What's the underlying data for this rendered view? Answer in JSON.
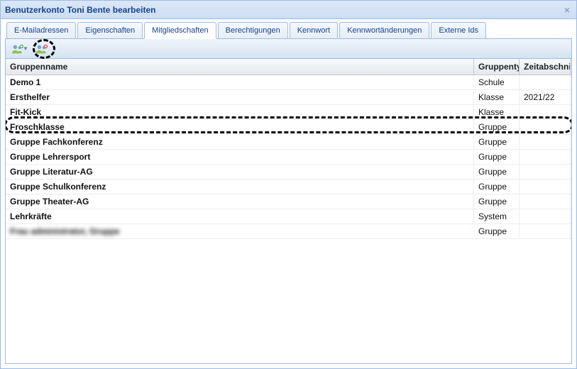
{
  "window": {
    "title": "Benutzerkonto Toni Bente bearbeiten",
    "close_glyph": "×"
  },
  "tabs": [
    {
      "label": "E-Mailadressen",
      "active": false
    },
    {
      "label": "Eigenschaften",
      "active": false
    },
    {
      "label": "Mitgliedschaften",
      "active": true
    },
    {
      "label": "Berechtigungen",
      "active": false
    },
    {
      "label": "Kennwort",
      "active": false
    },
    {
      "label": "Kennwortänderungen",
      "active": false
    },
    {
      "label": "Externe Ids",
      "active": false
    }
  ],
  "toolbar": {
    "add_name": "add-membership-button",
    "remove_name": "remove-membership-button"
  },
  "columns": {
    "c1": "Gruppenname",
    "c2": "Gruppenty",
    "c3": "Zeitabschnit"
  },
  "rows": [
    {
      "name": "Demo 1",
      "type": "Schule",
      "period": ""
    },
    {
      "name": "Ersthelfer",
      "type": "Klasse",
      "period": "2021/22"
    },
    {
      "name": "Fit-Kick",
      "type": "Klasse",
      "period": ""
    },
    {
      "name": "Froschklasse",
      "type": "Gruppe",
      "period": ""
    },
    {
      "name": "Gruppe Fachkonferenz",
      "type": "Gruppe",
      "period": ""
    },
    {
      "name": "Gruppe Lehrersport",
      "type": "Gruppe",
      "period": ""
    },
    {
      "name": "Gruppe Literatur-AG",
      "type": "Gruppe",
      "period": ""
    },
    {
      "name": "Gruppe Schulkonferenz",
      "type": "Gruppe",
      "period": ""
    },
    {
      "name": "Gruppe Theater-AG",
      "type": "Gruppe",
      "period": ""
    },
    {
      "name": "Lehrkräfte",
      "type": "System",
      "period": ""
    },
    {
      "name": "Frau administrator, Gruppe",
      "type": "Gruppe",
      "period": "",
      "blurred": true
    }
  ]
}
